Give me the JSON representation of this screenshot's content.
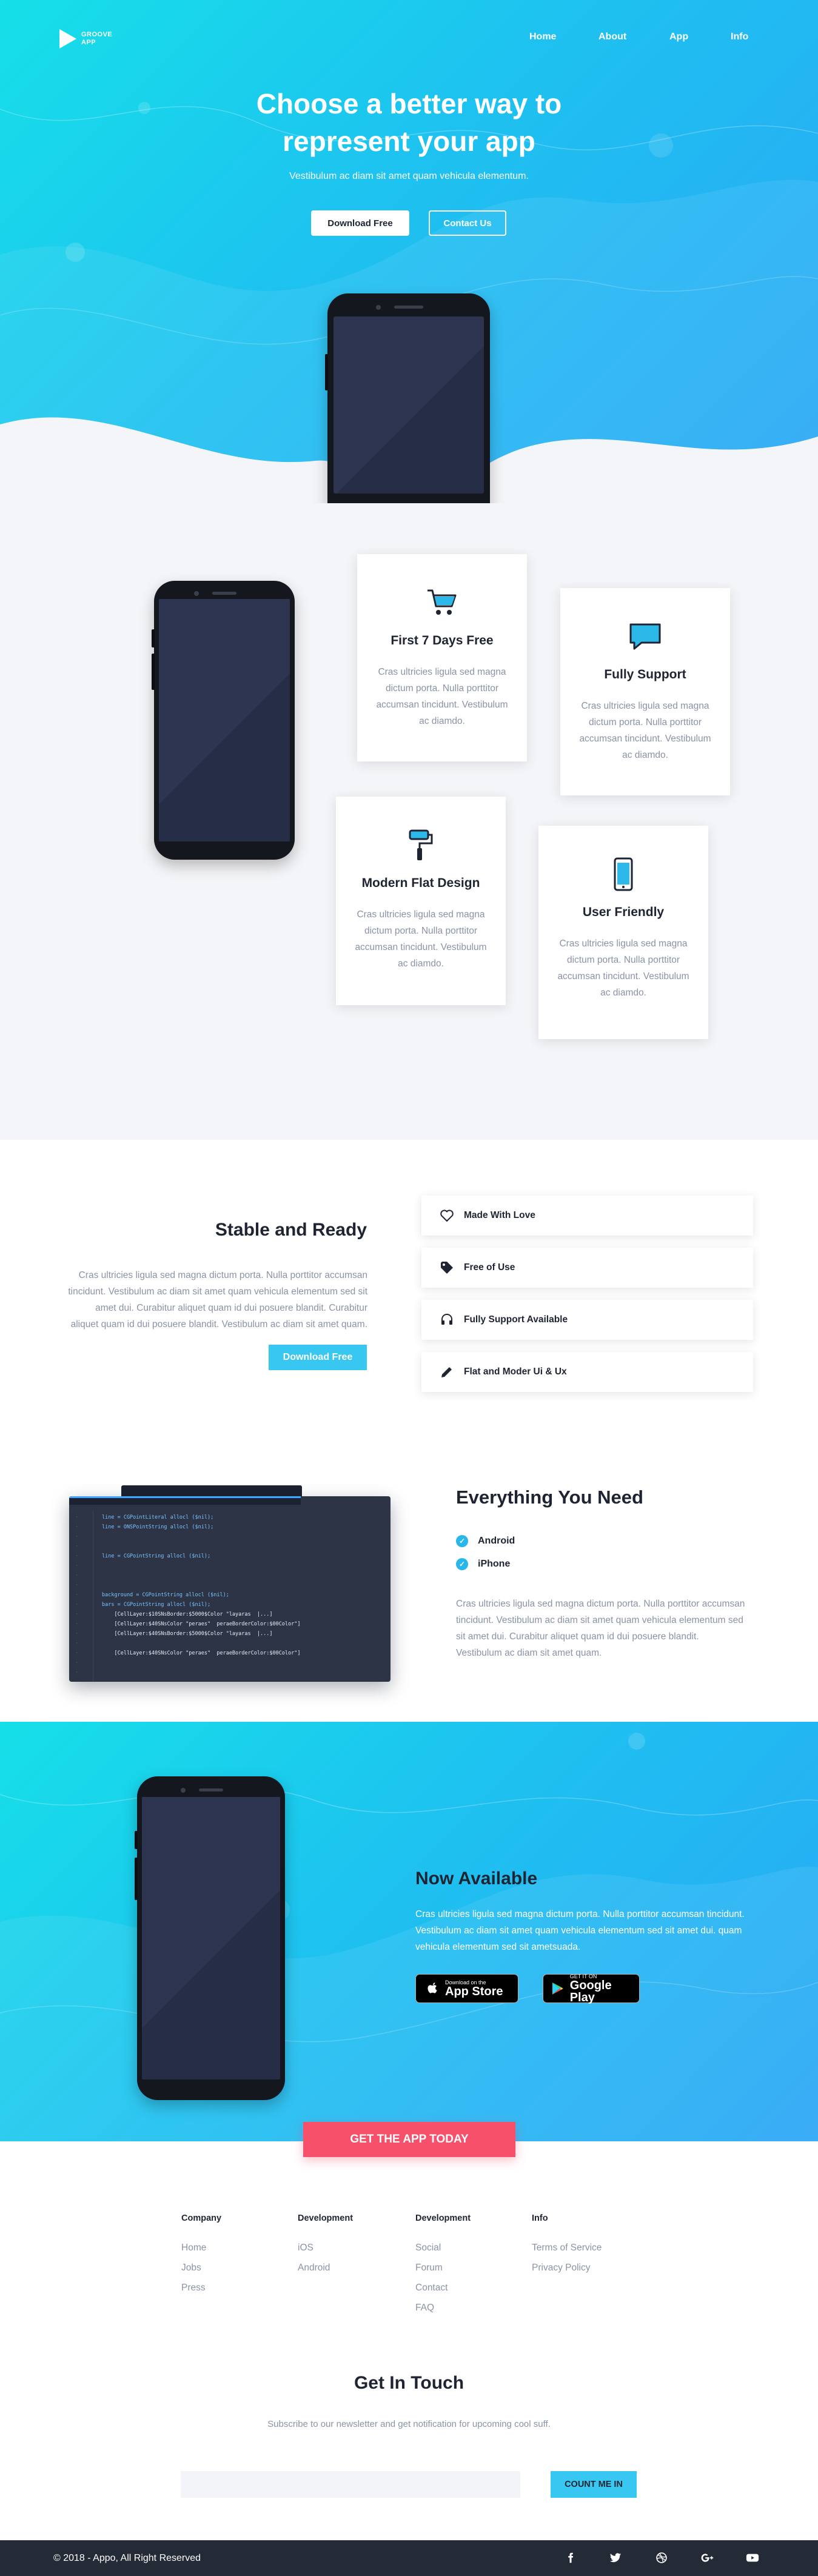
{
  "brand": {
    "line1": "GROOVE",
    "line2": "APP"
  },
  "nav": [
    "Home",
    "About",
    "App",
    "Info"
  ],
  "hero": {
    "title_line1": "Choose a better way to",
    "title_line2": "represent your app",
    "subtitle": "Vestibulum ac diam sit amet quam vehicula elementum.",
    "primary_button": "Download Free",
    "secondary_button": "Contact Us"
  },
  "features": [
    {
      "title": "First 7 Days Free",
      "text": "Cras ultricies ligula sed magna dictum porta. Nulla porttitor accumsan tincidunt. Vestibulum ac diamdo.",
      "icon": "shopping-cart-icon"
    },
    {
      "title": "Fully Support",
      "text": "Cras ultricies ligula sed magna dictum porta. Nulla porttitor accumsan tincidunt. Vestibulum ac diamdo.",
      "icon": "chat-bubble-icon"
    },
    {
      "title": "Modern Flat Design",
      "text": "Cras ultricies ligula sed magna dictum porta. Nulla porttitor accumsan tincidunt. Vestibulum ac diamdo.",
      "icon": "paint-roller-icon"
    },
    {
      "title": "User Friendly",
      "text": "Cras ultricies ligula sed magna dictum porta. Nulla porttitor accumsan tincidunt. Vestibulum ac diamdo.",
      "icon": "smartphone-icon"
    }
  ],
  "stable": {
    "title": "Stable and Ready",
    "text": "Cras ultricies ligula sed magna dictum porta. Nulla porttitor accumsan tincidunt. Vestibulum ac diam sit amet quam vehicula elementum sed sit amet dui. Curabitur aliquet quam id dui posuere blandit. Curabitur aliquet quam id dui posuere blandit. Vestibulum ac diam sit amet quam.",
    "button": "Download Free",
    "list": [
      {
        "label": "Made With Love",
        "icon": "heart-icon"
      },
      {
        "label": "Free of Use",
        "icon": "tag-icon"
      },
      {
        "label": "Fully Support Available",
        "icon": "headset-icon"
      },
      {
        "label": "Flat and Moder Ui & Ux",
        "icon": "pencil-icon"
      }
    ]
  },
  "code": {
    "lines": [
      "line = CGPointLiteral allocl ($nil);",
      "line = ONSPointString allocl ($nil);",
      "",
      "",
      "line = CGPointString allocl ($nil);",
      "",
      "",
      "",
      "background = CGPointString allocl ($nil);",
      "bars = CGPointString allocl ($nil);",
      "    [CellLayer:$10SNsBorder:$5000$Color \"layaras  |...]",
      "    [CellLayer:$40SNsColor \"peraes\"  peraeBorderColor:$00Color\"]",
      "    [CellLayer:$40SNsBorder:$5000$Color \"layaras  |...]",
      "",
      "    [CellLayer:$40SNsColor \"peraes\"  peraeBorderColor:$00Color\"]"
    ]
  },
  "everything": {
    "title": "Everything You Need",
    "items": [
      "Android",
      "iPhone"
    ],
    "text": "Cras ultricies ligula sed magna dictum porta. Nulla porttitor accumsan tincidunt. Vestibulum ac diam sit amet quam vehicula elementum sed sit amet dui. Curabitur aliquet quam id dui posuere blandit. Vestibulum ac diam sit amet quam."
  },
  "available": {
    "title": "Now Available",
    "text": "Cras ultricies ligula sed magna dictum porta. Nulla porttitor accumsan tincidunt. Vestibulum ac diam sit amet quam vehicula elementum sed sit amet dui. quam vehicula elementum sed sit ametsuada.",
    "appstore_small": "Download on the",
    "appstore_big": "App Store",
    "gplay_small": "GET IT ON",
    "gplay_big": "Google Play",
    "cta": "GET THE APP TODAY"
  },
  "footer": {
    "columns": [
      {
        "title": "Company",
        "links": [
          "Home",
          "Jobs",
          "Press"
        ]
      },
      {
        "title": "Development",
        "links": [
          "iOS",
          "Android"
        ]
      },
      {
        "title": "Development",
        "links": [
          "Social",
          "Forum",
          "Contact",
          "FAQ"
        ]
      },
      {
        "title": "Info",
        "links": [
          "Terms of Service",
          "Privacy Policy"
        ]
      }
    ]
  },
  "newsletter": {
    "title": "Get In Touch",
    "subtitle": "Subscribe to our newsletter and get notification for upcoming cool suff.",
    "placeholder": "",
    "button": "COUNT ME IN"
  },
  "bottom": {
    "copyright": "© 2018 - Appo, All Right Reserved",
    "social": [
      "facebook-icon",
      "twitter-icon",
      "dribbble-icon",
      "google-plus-icon",
      "youtube-icon"
    ]
  },
  "colors": {
    "accent": "#37c7f1",
    "cta": "#f7506b",
    "dark": "#252a37"
  }
}
